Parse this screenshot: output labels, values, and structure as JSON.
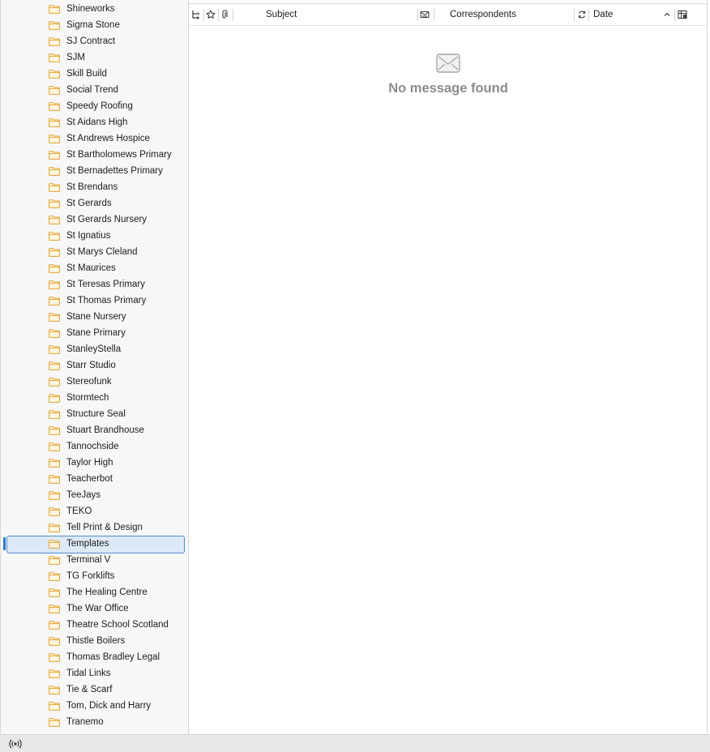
{
  "sidebar": {
    "folders": [
      {
        "label": "Shineworks"
      },
      {
        "label": "Sigma Stone"
      },
      {
        "label": "SJ Contract"
      },
      {
        "label": "SJM"
      },
      {
        "label": "Skill Build"
      },
      {
        "label": "Social Trend"
      },
      {
        "label": "Speedy Roofing"
      },
      {
        "label": "St Aidans High"
      },
      {
        "label": "St Andrews Hospice"
      },
      {
        "label": "St Bartholomews Primary"
      },
      {
        "label": "St Bernadettes Primary"
      },
      {
        "label": "St Brendans"
      },
      {
        "label": "St Gerards"
      },
      {
        "label": "St Gerards Nursery"
      },
      {
        "label": "St Ignatius"
      },
      {
        "label": "St Marys Cleland"
      },
      {
        "label": "St Maurices"
      },
      {
        "label": "St Teresas Primary"
      },
      {
        "label": "St Thomas Primary"
      },
      {
        "label": "Stane Nursery"
      },
      {
        "label": "Stane Primary"
      },
      {
        "label": "StanleyStella"
      },
      {
        "label": "Starr Studio"
      },
      {
        "label": "Stereofunk"
      },
      {
        "label": "Stormtech"
      },
      {
        "label": "Structure Seal"
      },
      {
        "label": "Stuart Brandhouse"
      },
      {
        "label": "Tannochside"
      },
      {
        "label": "Taylor High"
      },
      {
        "label": "Teacherbot"
      },
      {
        "label": "TeeJays"
      },
      {
        "label": "TEKO"
      },
      {
        "label": "Tell Print & Design"
      },
      {
        "label": "Templates",
        "selected": true
      },
      {
        "label": "Terminal V"
      },
      {
        "label": "TG Forklifts"
      },
      {
        "label": "The Healing Centre"
      },
      {
        "label": "The War Office"
      },
      {
        "label": "Theatre School Scotland"
      },
      {
        "label": "Thistle Boilers"
      },
      {
        "label": "Thomas Bradley Legal"
      },
      {
        "label": "Tidal Links"
      },
      {
        "label": "Tie & Scarf"
      },
      {
        "label": "Tom, Dick and Harry"
      },
      {
        "label": "Tranemo"
      }
    ],
    "folder_icon": "folder-icon",
    "folder_icon_color": "#e0a12c"
  },
  "message_list": {
    "columns": {
      "thread_icon": "thread-icon",
      "star_icon": "star-icon",
      "attachment_icon": "attachment-icon",
      "subject": "Subject",
      "spam_icon": "spam-icon",
      "correspondents": "Correspondents",
      "read_status_icon": "read-status-icon",
      "date": "Date",
      "sort_direction": "ascending",
      "column_picker_icon": "column-picker-icon"
    },
    "empty_state": {
      "icon": "envelope-icon",
      "message": "No message found"
    }
  },
  "statusbar": {
    "icon": "online-status-icon"
  },
  "colors": {
    "selection_bg": "#dde9f6",
    "selection_border": "#4d8fca",
    "accent": "#2a78c9",
    "folder": "#e0a12c",
    "empty_text": "#8b8b90"
  }
}
